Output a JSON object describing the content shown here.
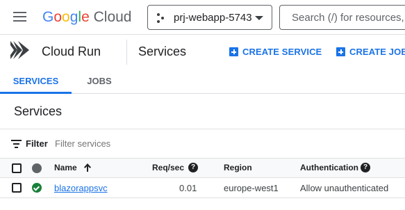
{
  "topbar": {
    "logo": {
      "google_letters": [
        {
          "ch": "G",
          "color": "#4285f4"
        },
        {
          "ch": "o",
          "color": "#ea4335"
        },
        {
          "ch": "o",
          "color": "#fbbc04"
        },
        {
          "ch": "g",
          "color": "#4285f4"
        },
        {
          "ch": "l",
          "color": "#34a853"
        },
        {
          "ch": "e",
          "color": "#ea4335"
        }
      ],
      "cloud": "Cloud"
    },
    "project": "prj-webapp-5743",
    "search_placeholder": "Search (/) for resources,"
  },
  "header": {
    "product": "Cloud Run",
    "page": "Services",
    "create_service": "CREATE SERVICE",
    "create_job": "CREATE JOB"
  },
  "tabs": [
    {
      "label": "SERVICES",
      "active": true
    },
    {
      "label": "JOBS",
      "active": false
    }
  ],
  "section": {
    "title": "Services",
    "filter_label": "Filter",
    "filter_placeholder": "Filter services"
  },
  "table": {
    "columns": {
      "name": "Name",
      "req": "Req/sec",
      "region": "Region",
      "auth": "Authentication"
    },
    "help_glyph": "?",
    "rows": [
      {
        "name": "blazorappsvc",
        "req": "0.01",
        "region": "europe-west1",
        "auth": "Allow unauthenticated",
        "status": "ok"
      }
    ]
  },
  "colors": {
    "accent": "#1a73e8",
    "status_ok": "#188038",
    "run_icon": "#3c4043"
  }
}
